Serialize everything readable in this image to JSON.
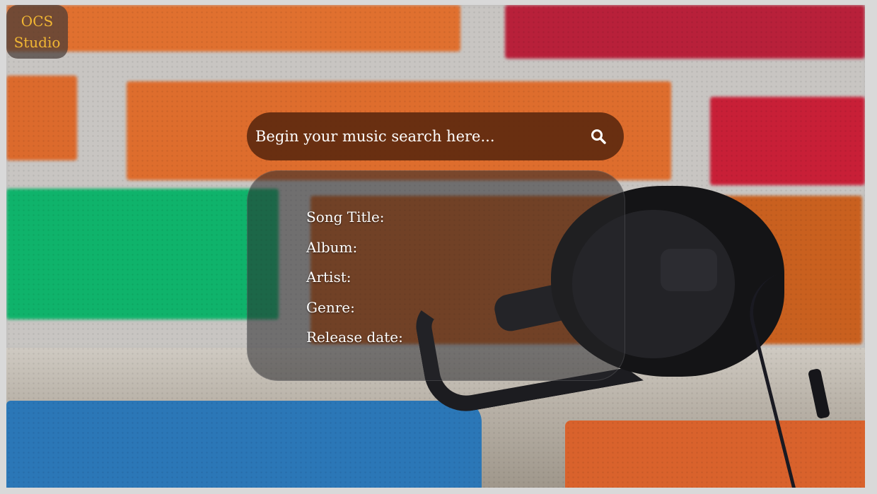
{
  "logo": {
    "line1": "OCS",
    "line2": "Studio"
  },
  "search": {
    "placeholder": "Begin your music search here...",
    "icon": "search-icon"
  },
  "info": {
    "song_title_label": "Song Title:",
    "album_label": "Album:",
    "artist_label": "Artist:",
    "genre_label": "Genre:",
    "release_date_label": "Release date:"
  },
  "colors": {
    "logo_text": "#f2b733",
    "search_bg": "#5c280e",
    "panel_bg": "#28282c",
    "text": "#ffffff"
  }
}
